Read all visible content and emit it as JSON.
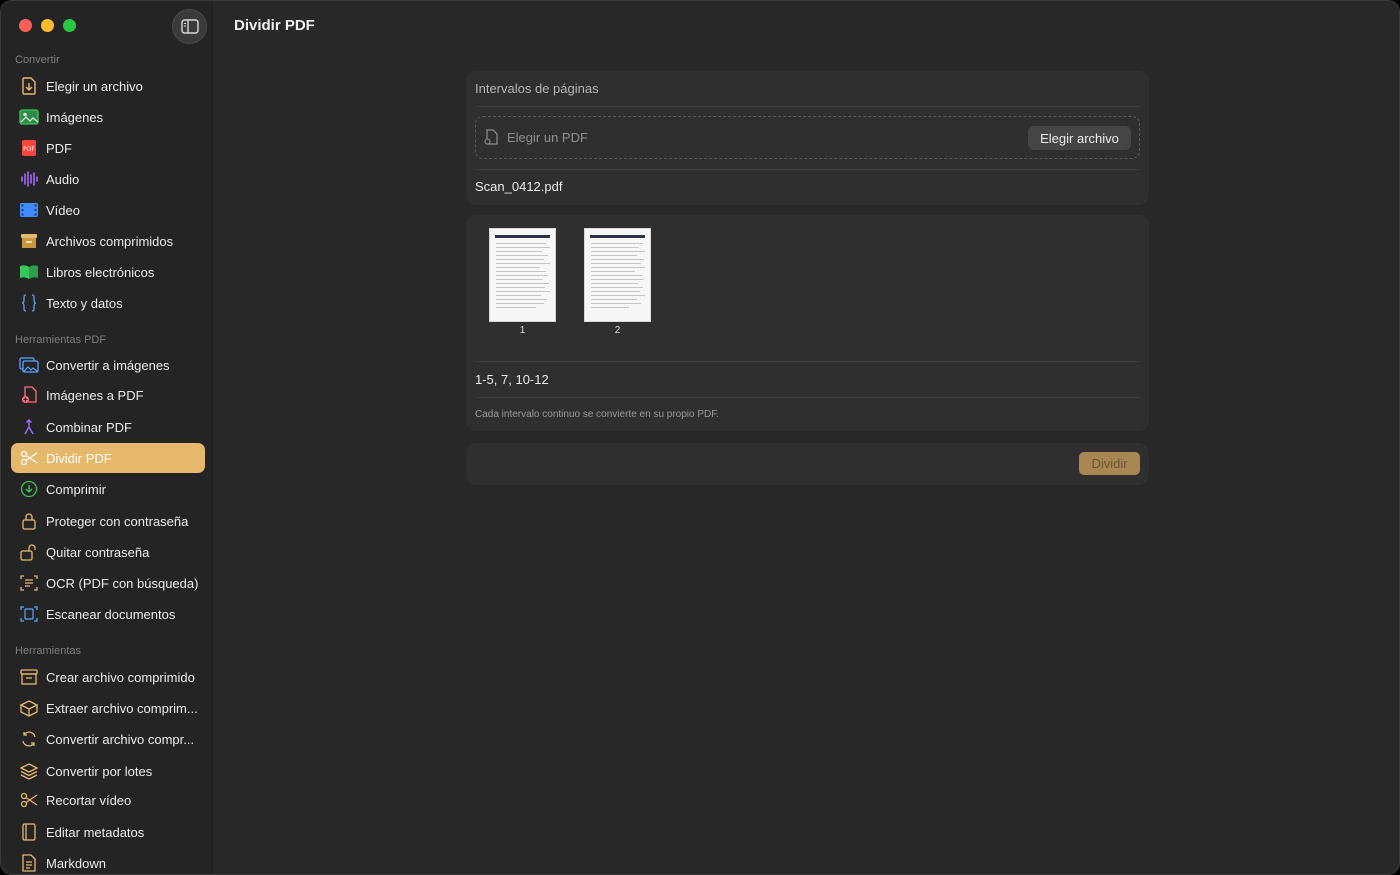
{
  "window": {
    "title": "Dividir PDF"
  },
  "sidebar": {
    "sections": {
      "convertir": "Convertir",
      "herramientas_pdf": "Herramientas PDF",
      "herramientas": "Herramientas"
    },
    "items": [
      {
        "label": "Elegir un archivo",
        "icon": "file-import-icon",
        "color": "#e6b86c"
      },
      {
        "label": "Imágenes",
        "icon": "photo-icon",
        "color": "#35c759"
      },
      {
        "label": "PDF",
        "icon": "pdf-icon",
        "color": "#ff453a"
      },
      {
        "label": "Audio",
        "icon": "waveform-icon",
        "color": "#a36bff"
      },
      {
        "label": "Vídeo",
        "icon": "film-icon",
        "color": "#3f8cff"
      },
      {
        "label": "Archivos comprimidos",
        "icon": "archive-box-icon",
        "color": "#e6b86c"
      },
      {
        "label": "Libros electrónicos",
        "icon": "book-icon",
        "color": "#35c759"
      },
      {
        "label": "Texto y datos",
        "icon": "braces-icon",
        "color": "#5aa3ff"
      },
      {
        "label": "Convertir a imágenes",
        "icon": "photo-stack-icon",
        "color": "#5aa3ff"
      },
      {
        "label": "Imágenes a PDF",
        "icon": "doc-plus-icon",
        "color": "#ff6b8a"
      },
      {
        "label": "Combinar PDF",
        "icon": "merge-icon",
        "color": "#a36bff"
      },
      {
        "label": "Dividir PDF",
        "icon": "scissors-icon",
        "color": "#ffffff",
        "active": true
      },
      {
        "label": "Comprimir",
        "icon": "arrow-down-circle-icon",
        "color": "#35c759"
      },
      {
        "label": "Proteger con contraseña",
        "icon": "lock-icon",
        "color": "#e6b86c"
      },
      {
        "label": "Quitar contraseña",
        "icon": "unlock-icon",
        "color": "#e6b86c"
      },
      {
        "label": "OCR (PDF con búsqueda)",
        "icon": "text-scan-icon",
        "color": "#e6b86c"
      },
      {
        "label": "Escanear documentos",
        "icon": "doc-scan-icon",
        "color": "#5aa3ff"
      },
      {
        "label": "Crear archivo comprimido",
        "icon": "archive-icon",
        "color": "#e6b86c"
      },
      {
        "label": "Extraer archivo comprim...",
        "icon": "box-open-icon",
        "color": "#e6b86c"
      },
      {
        "label": "Convertir archivo compr...",
        "icon": "refresh-icon",
        "color": "#e6b86c"
      },
      {
        "label": "Convertir por lotes",
        "icon": "layers-icon",
        "color": "#e6b86c"
      },
      {
        "label": "Recortar vídeo",
        "icon": "scissors-icon",
        "color": "#e6b86c"
      },
      {
        "label": "Editar metadatos",
        "icon": "book-closed-icon",
        "color": "#e6b86c"
      },
      {
        "label": "Markdown",
        "icon": "doc-text-icon",
        "color": "#e6b86c"
      }
    ]
  },
  "main": {
    "ranges_label": "Intervalos de páginas",
    "dropzone_placeholder": "Elegir un PDF",
    "choose_button": "Elegir archivo",
    "filename": "Scan_0412.pdf",
    "pages": [
      "1",
      "2"
    ],
    "range_value": "1-5, 7, 10-12",
    "help_text": "Cada intervalo continuo se convierte en su propio PDF.",
    "split_button": "Dividir"
  }
}
